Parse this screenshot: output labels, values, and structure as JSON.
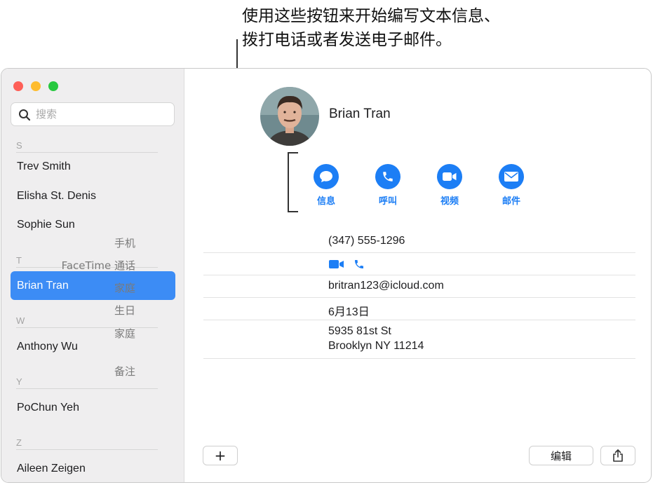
{
  "callout": {
    "line1": "使用这些按钮来开始编写文本信息、",
    "line2": "拨打电话或者发送电子邮件。"
  },
  "sidebar": {
    "search_placeholder": "搜索",
    "sections": [
      {
        "letter": "S",
        "contacts": [
          "Trev Smith",
          "Elisha St. Denis",
          "Sophie Sun"
        ]
      },
      {
        "letter": "T",
        "contacts": [
          "Brian Tran"
        ]
      },
      {
        "letter": "W",
        "contacts": [
          "Anthony Wu"
        ]
      },
      {
        "letter": "Y",
        "contacts": [
          "PoChun Yeh"
        ]
      },
      {
        "letter": "Z",
        "contacts": [
          "Aileen Zeigen"
        ]
      }
    ],
    "selected_contact": "Brian Tran"
  },
  "contact": {
    "name": "Brian Tran",
    "actions": [
      {
        "label": "信息",
        "icon": "message-bubble-icon"
      },
      {
        "label": "呼叫",
        "icon": "phone-icon"
      },
      {
        "label": "视频",
        "icon": "video-camera-icon"
      },
      {
        "label": "邮件",
        "icon": "envelope-icon"
      }
    ],
    "fields": [
      {
        "label": "手机",
        "value": "(347) 555-1296"
      },
      {
        "label": "FaceTime 通话",
        "value": ""
      },
      {
        "label": "家庭",
        "value": "britran123@icloud.com"
      },
      {
        "label": "生日",
        "value": "6月13日"
      },
      {
        "label": "家庭",
        "value_line1": "5935 81st St",
        "value_line2": "Brooklyn NY 11214"
      },
      {
        "label": "备注",
        "value": ""
      }
    ]
  },
  "footer": {
    "add_label": "+",
    "edit_label": "编辑"
  },
  "colors": {
    "accent": "#1c7ef5",
    "selection": "#3c8cf5",
    "sidebar_bg": "#efeeef"
  }
}
